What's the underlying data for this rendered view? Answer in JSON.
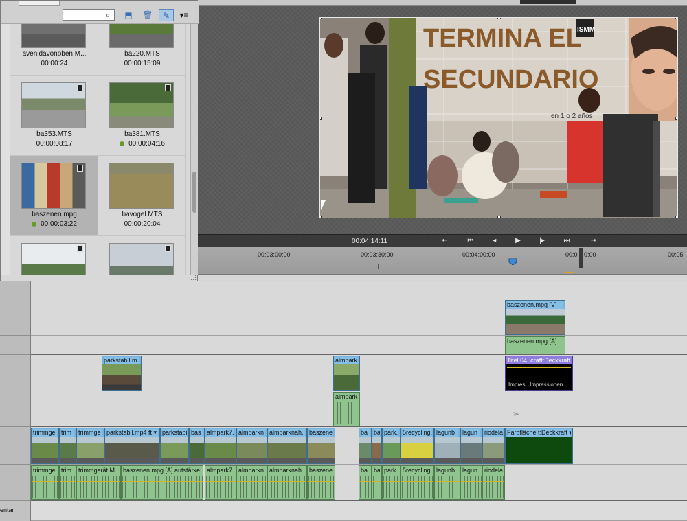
{
  "project_panel": {
    "search": {
      "value": "",
      "placeholder": ""
    },
    "toolbar_icons": [
      "search-icon",
      "folder-up-icon",
      "trash-icon",
      "pin-icon",
      "panel-menu-icon"
    ],
    "items": [
      {
        "name": "avenidavonoben.M...",
        "duration": "00:00:24",
        "status": "none"
      },
      {
        "name": "ba220.MTS",
        "duration": "00:00:15:09",
        "status": "none"
      },
      {
        "name": "ba353.MTS",
        "duration": "00:00:08:17",
        "status": "none"
      },
      {
        "name": "ba381.MTS",
        "duration": "00:00:04:16",
        "status": "used"
      },
      {
        "name": "baszenen.mpg",
        "duration": "00:00:03:22",
        "status": "used"
      },
      {
        "name": "bavogel.MTS",
        "duration": "00:00:20:04",
        "status": "none"
      },
      {
        "name": "",
        "duration": "",
        "status": "none"
      },
      {
        "name": "",
        "duration": "",
        "status": "none"
      }
    ]
  },
  "monitor": {
    "preview_text": {
      "line1": "TERMINA EL",
      "line2": "SECUNDARIO",
      "brand": "ISMM",
      "sub": "en 1 o 2 años"
    },
    "timecode": "00:04:14:11",
    "transport_icons": [
      "go-to-in-icon",
      "go-to-start-icon",
      "step-back-icon",
      "play-icon",
      "step-forward-icon",
      "go-to-end-icon",
      "go-to-out-icon"
    ]
  },
  "ruler": {
    "labels": [
      "00:03:00:00",
      "00:03:30:00",
      "00:04:00:00",
      "00:0",
      "0:00",
      "00:05"
    ]
  },
  "timeline": {
    "tracks": {
      "upper_video": [
        {
          "label": "baszenen.mpg [V]"
        }
      ],
      "upper_audio": [
        {
          "label": "baszenen.mpg [A]"
        }
      ],
      "title_video": [
        {
          "label": "parkstabil.m"
        },
        {
          "label": "almpark."
        },
        {
          "label": "Titel 04",
          "fx": "craft:Deckkraft"
        }
      ],
      "title_audio": [
        {
          "label": "almpark."
        }
      ],
      "main_video": [
        {
          "label": "trimmge"
        },
        {
          "label": "trim"
        },
        {
          "label": "trimmge"
        },
        {
          "label": "parkstabil.mp4",
          "fx": "ft"
        },
        {
          "label": "parkstabi"
        },
        {
          "label": "bas"
        },
        {
          "label": "almpark7."
        },
        {
          "label": "almparkn"
        },
        {
          "label": "almparknah."
        },
        {
          "label": "baszene"
        },
        {
          "label": "ba"
        },
        {
          "label": "ba"
        },
        {
          "label": "park."
        },
        {
          "label": "5recycling."
        },
        {
          "label": "lagunb"
        },
        {
          "label": "lagun"
        },
        {
          "label": "riodela"
        },
        {
          "label": "Farbfläche",
          "fx": "t:Deckkraft"
        }
      ],
      "main_audio": [
        {
          "label": "trimmge"
        },
        {
          "label": "trim"
        },
        {
          "label": "trimmgerät.M"
        },
        {
          "label": "baszenen.mpg [A]",
          "fx": "autstärke"
        },
        {
          "label": "almpark7."
        },
        {
          "label": "almparkn"
        },
        {
          "label": "almparknah."
        },
        {
          "label": "baszene"
        },
        {
          "label": "ba"
        },
        {
          "label": "ba"
        },
        {
          "label": "park."
        },
        {
          "label": "5recycling."
        },
        {
          "label": "lagunb"
        },
        {
          "label": "lagun"
        },
        {
          "label": "riodela"
        }
      ]
    },
    "bottom_track_label": "entar",
    "scissors_icon": "scissors-icon"
  },
  "colors": {
    "video_clip": "#78b2de",
    "audio_clip": "#8fc48f",
    "title_clip": "#8e7ddc",
    "playhead": "#e04040",
    "used_dot": "#6a9a2a"
  }
}
